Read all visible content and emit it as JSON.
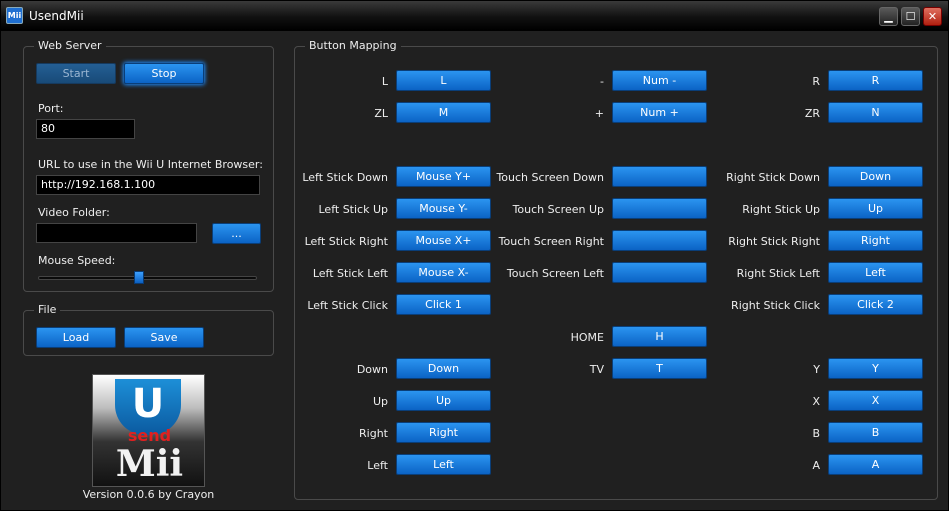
{
  "window": {
    "title": "UsendMii",
    "icon_text": "Mii",
    "minimize": "▁",
    "maximize": "☐",
    "close": "✕"
  },
  "web_server": {
    "title": "Web Server",
    "start_label": "Start",
    "stop_label": "Stop",
    "port_label": "Port:",
    "port_value": "80",
    "url_label": "URL to use in the Wii U Internet Browser:",
    "url_value": "http://192.168.1.100",
    "video_folder_label": "Video Folder:",
    "video_folder_value": "",
    "browse_label": "...",
    "mouse_speed_label": "Mouse Speed:",
    "mouse_speed_fraction": 0.46
  },
  "file": {
    "title": "File",
    "load_label": "Load",
    "save_label": "Save"
  },
  "logo": {
    "u": "U",
    "send": "send",
    "mii": "Mii"
  },
  "version": "Version 0.0.6 by Crayon",
  "mapping": {
    "title": "Button Mapping",
    "rows": [
      {
        "label": "L",
        "value": "L"
      },
      {
        "label": "-",
        "value": "Num -"
      },
      {
        "label": "R",
        "value": "R"
      },
      {
        "label": "ZL",
        "value": "M"
      },
      {
        "label": "+",
        "value": "Num +"
      },
      {
        "label": "ZR",
        "value": "N"
      },
      {
        "label": "Left Stick Down",
        "value": "Mouse Y+"
      },
      {
        "label": "Touch Screen Down",
        "value": ""
      },
      {
        "label": "Right Stick Down",
        "value": "Down"
      },
      {
        "label": "Left Stick Up",
        "value": "Mouse Y-"
      },
      {
        "label": "Touch Screen Up",
        "value": ""
      },
      {
        "label": "Right Stick Up",
        "value": "Up"
      },
      {
        "label": "Left Stick Right",
        "value": "Mouse X+"
      },
      {
        "label": "Touch Screen Right",
        "value": ""
      },
      {
        "label": "Right Stick Right",
        "value": "Right"
      },
      {
        "label": "Left Stick Left",
        "value": "Mouse X-"
      },
      {
        "label": "Touch Screen Left",
        "value": ""
      },
      {
        "label": "Right Stick Left",
        "value": "Left"
      },
      {
        "label": "Left Stick Click",
        "value": "Click 1"
      },
      {
        "label": "Right Stick Click",
        "value": "Click 2"
      },
      {
        "label": "HOME",
        "value": "H"
      },
      {
        "label": "Down",
        "value": "Down"
      },
      {
        "label": "TV",
        "value": "T"
      },
      {
        "label": "Y",
        "value": "Y"
      },
      {
        "label": "Up",
        "value": "Up"
      },
      {
        "label": "X",
        "value": "X"
      },
      {
        "label": "Right",
        "value": "Right"
      },
      {
        "label": "B",
        "value": "B"
      },
      {
        "label": "Left",
        "value": "Left"
      },
      {
        "label": "A",
        "value": "A"
      }
    ]
  }
}
